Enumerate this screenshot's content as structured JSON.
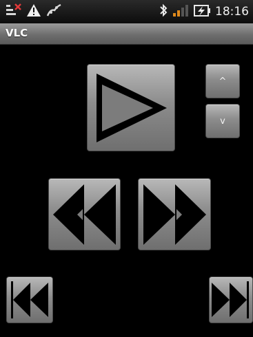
{
  "status_bar": {
    "time": "18:16",
    "icons": [
      "notification-icon",
      "warning-icon",
      "usb-debug-icon",
      "bluetooth-icon",
      "signal-icon",
      "battery-charging-icon"
    ]
  },
  "app": {
    "title": "VLC"
  },
  "controls": {
    "play": {
      "icon": "play-icon"
    },
    "volume_up": {
      "label": "^",
      "icon": "volume-up-icon"
    },
    "volume_down": {
      "label": "v",
      "icon": "volume-down-icon"
    },
    "rewind": {
      "icon": "rewind-icon"
    },
    "fast_forward": {
      "icon": "fast-forward-icon"
    },
    "previous": {
      "icon": "skip-previous-icon"
    },
    "next": {
      "icon": "skip-next-icon"
    }
  },
  "colors": {
    "background": "#000000",
    "button_top": "#b8b8b8",
    "button_bottom": "#6f6f6f",
    "glyph": "#000000"
  }
}
